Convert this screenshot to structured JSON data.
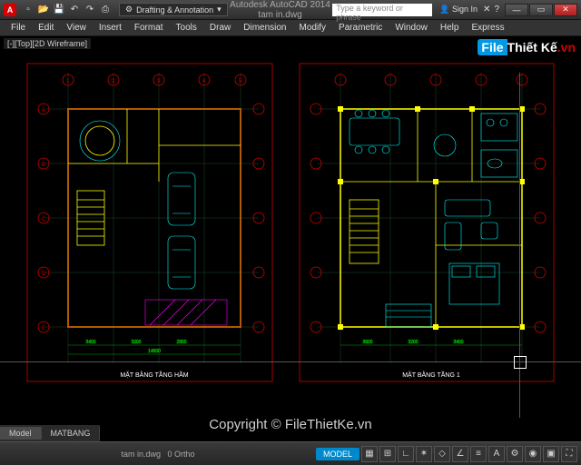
{
  "titlebar": {
    "app_letter": "A",
    "workspace": "Drafting & Annotation",
    "title": "Autodesk AutoCAD 2014   tam in.dwg",
    "search_placeholder": "Type a keyword or phrase",
    "signin": "Sign In",
    "min": "—",
    "max": "▭",
    "close": "✕"
  },
  "qat_icons": [
    "new",
    "open",
    "save",
    "undo",
    "redo",
    "plot"
  ],
  "menu": [
    "File",
    "Edit",
    "View",
    "Insert",
    "Format",
    "Tools",
    "Draw",
    "Dimension",
    "Modify",
    "Parametric",
    "Window",
    "Help",
    "Express"
  ],
  "view": {
    "label": "[-][Top][2D Wireframe]"
  },
  "watermark": {
    "brand_a": "File",
    "brand_b": "Thiết Kế",
    "tld": ".vn"
  },
  "captions": {
    "left": "MẶT BẰNG TẦNG HẦM",
    "right": "MẶT BẰNG TẦNG 1"
  },
  "grid_labels": {
    "cols": [
      "1",
      "2",
      "3",
      "4",
      "5"
    ],
    "rows": [
      "A",
      "B",
      "C",
      "D",
      "E"
    ]
  },
  "dims": {
    "d1": "3400",
    "d2": "3200",
    "d3": "2800",
    "d4": "14600",
    "d5": "3600"
  },
  "layout_tabs": {
    "active": "Model",
    "other": "MATBANG"
  },
  "status": {
    "filename": "tam in.dwg",
    "ortho": "0 Ortho",
    "model": "MODEL"
  },
  "copyright": "Copyright © FileThietKe.vn"
}
